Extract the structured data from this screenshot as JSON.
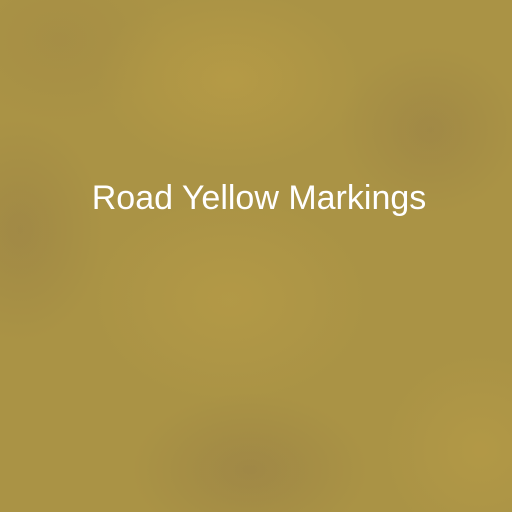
{
  "background": {
    "color": "#aa9345"
  },
  "label": {
    "text": "Road Yellow Markings",
    "color": "#ffffff"
  }
}
